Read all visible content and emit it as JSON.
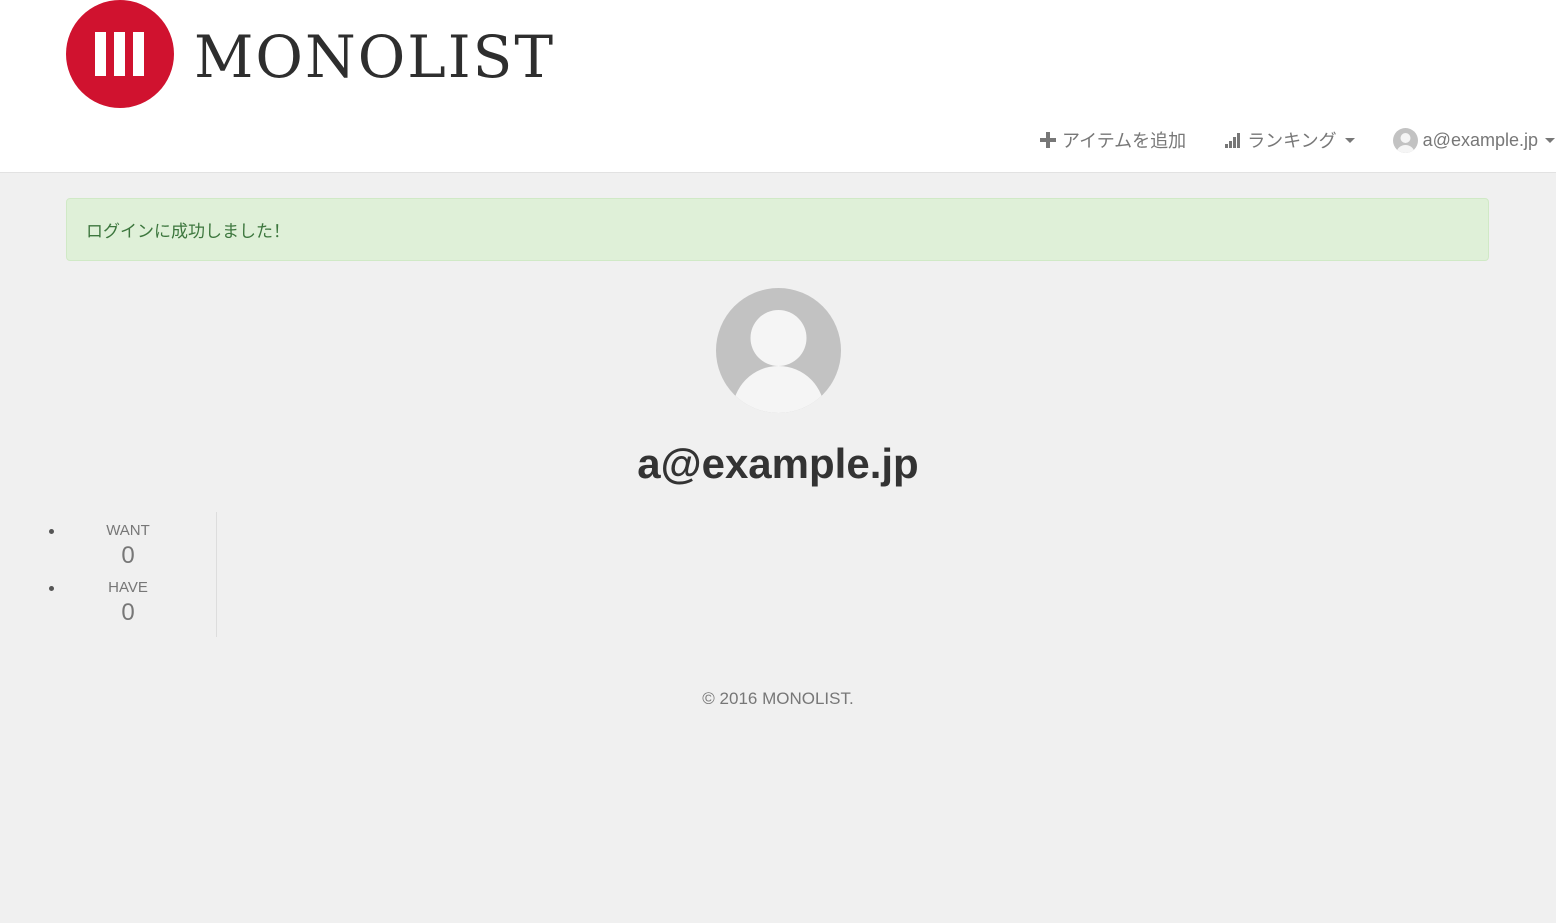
{
  "brand": {
    "name": "MONOLIST",
    "accent_color": "#d0122f"
  },
  "nav": {
    "add_item_label": "アイテムを追加",
    "add_item_icon": "plus-icon",
    "ranking_label": "ランキング",
    "ranking_icon": "signal-bars-icon",
    "user_label": "a@example.jp",
    "user_icon": "user-avatar-icon"
  },
  "alert": {
    "message": "ログインに成功しました！",
    "type": "success"
  },
  "profile": {
    "name": "a@example.jp",
    "avatar_icon": "default-user-avatar"
  },
  "counts": [
    {
      "label": "WANT",
      "value": "0"
    },
    {
      "label": "HAVE",
      "value": "0"
    }
  ],
  "footer": {
    "copyright": "© 2016 MONOLIST."
  }
}
